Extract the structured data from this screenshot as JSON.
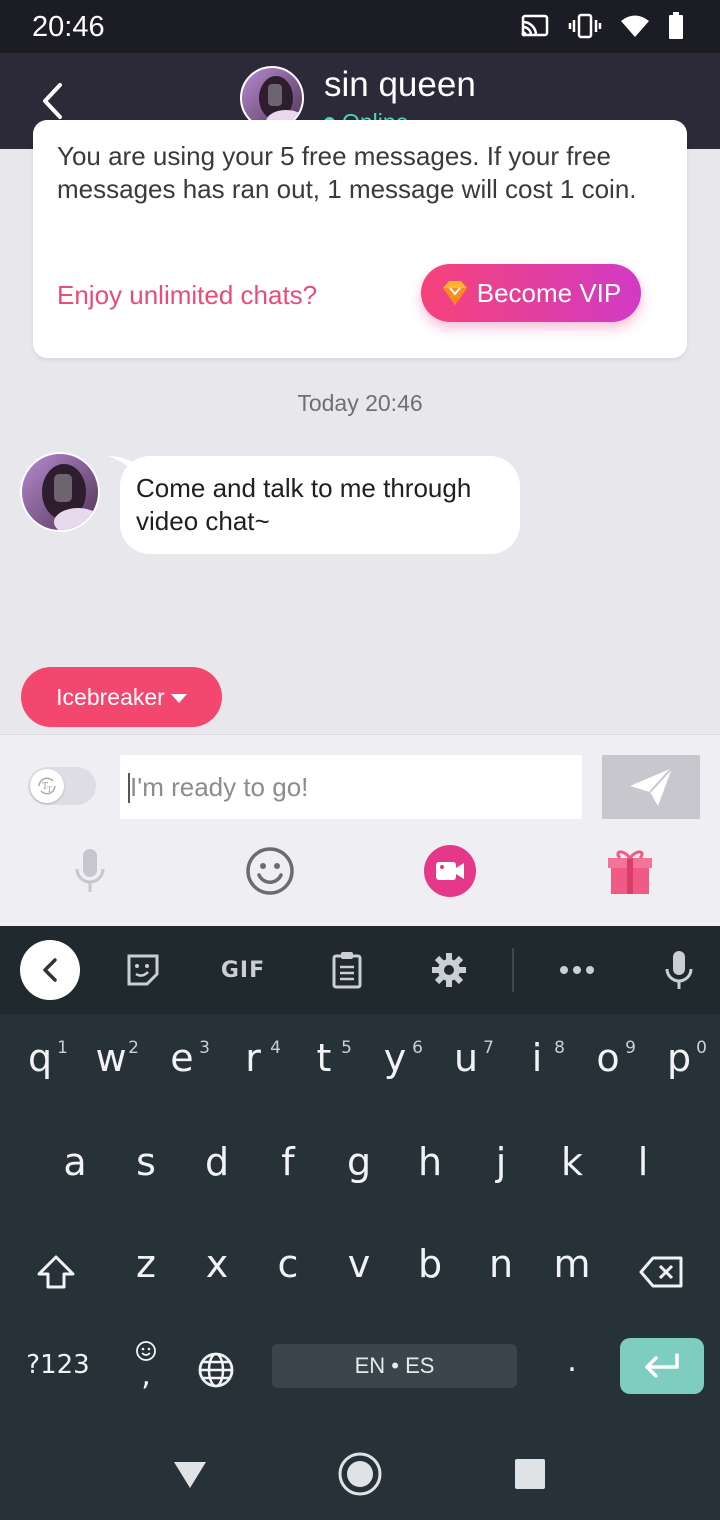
{
  "status_bar": {
    "time": "20:46",
    "icons": [
      "cast-icon",
      "vibrate-icon",
      "wifi-icon",
      "battery-icon"
    ]
  },
  "header": {
    "name": "sin queen",
    "status": "Online",
    "status_color": "#3fe0b6"
  },
  "free_card": {
    "text": "You are using your 5 free messages. If your free messages has ran out, 1 message will cost 1 coin.",
    "enjoy_label": "Enjoy unlimited chats?",
    "vip_button": "Become VIP",
    "accent": "#ec4a77"
  },
  "chat": {
    "date": "Today 20:46",
    "messages": [
      {
        "text": "Come and talk to me through video chat~"
      }
    ]
  },
  "icebreaker": {
    "label": "Icebreaker"
  },
  "composer": {
    "placeholder": "I'm ready to go!",
    "tools": [
      "microphone-icon",
      "emoji-icon",
      "video-call-icon",
      "gift-icon"
    ]
  },
  "keyboard": {
    "toolbar": {
      "gif_label": "GIF"
    },
    "row1": [
      {
        "key": "q",
        "hint": "1"
      },
      {
        "key": "w",
        "hint": "2"
      },
      {
        "key": "e",
        "hint": "3"
      },
      {
        "key": "r",
        "hint": "4"
      },
      {
        "key": "t",
        "hint": "5"
      },
      {
        "key": "y",
        "hint": "6"
      },
      {
        "key": "u",
        "hint": "7"
      },
      {
        "key": "i",
        "hint": "8"
      },
      {
        "key": "o",
        "hint": "9"
      },
      {
        "key": "p",
        "hint": "0"
      }
    ],
    "row2": [
      "a",
      "s",
      "d",
      "f",
      "g",
      "h",
      "j",
      "k",
      "l"
    ],
    "row3": [
      "z",
      "x",
      "c",
      "v",
      "b",
      "n",
      "m"
    ],
    "symbols_key": "?123",
    "comma_key": ",",
    "period_key": ".",
    "space_label": "EN • ES"
  },
  "colors": {
    "header_bg": "#2c2a38",
    "chat_bg": "#e8e7ec",
    "icebreaker": "#f3476f",
    "keyboard_bg": "#263238",
    "enter_key": "#7dcdc0"
  }
}
